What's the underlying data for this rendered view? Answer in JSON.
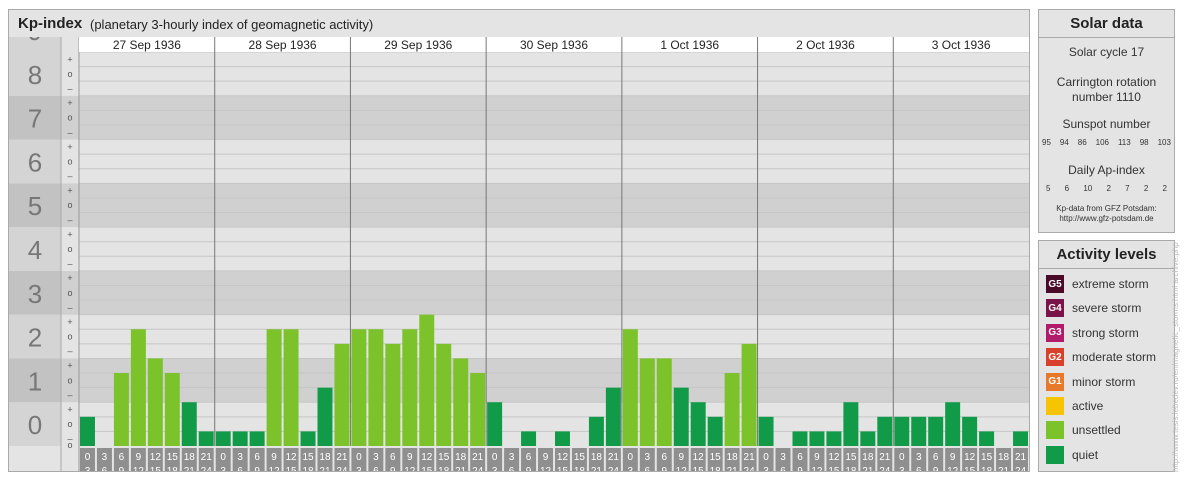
{
  "header": {
    "title": "Kp-index",
    "subtitle": "(planetary 3-hourly index of geomagnetic activity)"
  },
  "chart_data": {
    "type": "bar",
    "ylim": [
      0,
      9
    ],
    "y_ticks": [
      "0",
      "1",
      "2",
      "3",
      "4",
      "5",
      "6",
      "7",
      "8",
      "9"
    ],
    "minor_marks": [
      "–",
      "o",
      "+"
    ],
    "days": [
      "27 Sep 1936",
      "28 Sep 1936",
      "29 Sep 1936",
      "30 Sep 1936",
      "1 Oct 1936",
      "2 Oct 1936",
      "3 Oct 1936"
    ],
    "interval_start": [
      "0",
      "3",
      "6",
      "9",
      "12",
      "15",
      "18",
      "21"
    ],
    "interval_end": [
      "3",
      "6",
      "9",
      "12",
      "15",
      "18",
      "21",
      "24"
    ],
    "values": [
      [
        0.667,
        0,
        1.667,
        2.667,
        2,
        1.667,
        1,
        0.333
      ],
      [
        0.333,
        0.333,
        0.333,
        2.667,
        2.667,
        0.333,
        1.333,
        2.333
      ],
      [
        2.667,
        2.667,
        2.333,
        2.667,
        3,
        2.333,
        2,
        1.667
      ],
      [
        1,
        0,
        0.333,
        0,
        0.333,
        0,
        0.667,
        1.333
      ],
      [
        2.667,
        2,
        2,
        1.333,
        1,
        0.667,
        1.667,
        2.333
      ],
      [
        0.667,
        0,
        0.333,
        0.333,
        0.333,
        1,
        0.333,
        0.667
      ],
      [
        0.667,
        0.667,
        0.667,
        1,
        0.667,
        0.333,
        0,
        0.333
      ]
    ],
    "colors": {
      "quiet": "#119a48",
      "unsettled": "#7cc22a"
    }
  },
  "solar": {
    "title": "Solar data",
    "cycle": "Solar cycle 17",
    "carrington_1": "Carrington rotation",
    "carrington_2": "number 1110",
    "sunspot_label": "Sunspot number",
    "sunspot": [
      "95",
      "94",
      "86",
      "106",
      "113",
      "98",
      "103"
    ],
    "ap_label": "Daily Ap-index",
    "ap": [
      "5",
      "6",
      "10",
      "2",
      "7",
      "2",
      "2"
    ],
    "credit_1": "Kp-data from GFZ Potsdam:",
    "credit_2": "http://www.gfz-potsdam.de"
  },
  "activity": {
    "title": "Activity levels",
    "levels": [
      {
        "badge": "G5",
        "label": "extreme storm",
        "color": "#4a0a2a"
      },
      {
        "badge": "G4",
        "label": "severe storm",
        "color": "#7a1448"
      },
      {
        "badge": "G3",
        "label": "strong storm",
        "color": "#b01b6a"
      },
      {
        "badge": "G2",
        "label": "moderate storm",
        "color": "#d9402b"
      },
      {
        "badge": "G1",
        "label": "minor storm",
        "color": "#e8782a"
      },
      {
        "badge": "",
        "label": "active",
        "color": "#f6c400"
      },
      {
        "badge": "",
        "label": "unsettled",
        "color": "#7cc22a"
      },
      {
        "badge": "",
        "label": "quiet",
        "color": "#119a48"
      }
    ]
  },
  "watermark": "http://www.tesis.lebedev.ru/en/magnetic_storms.html archive.php"
}
